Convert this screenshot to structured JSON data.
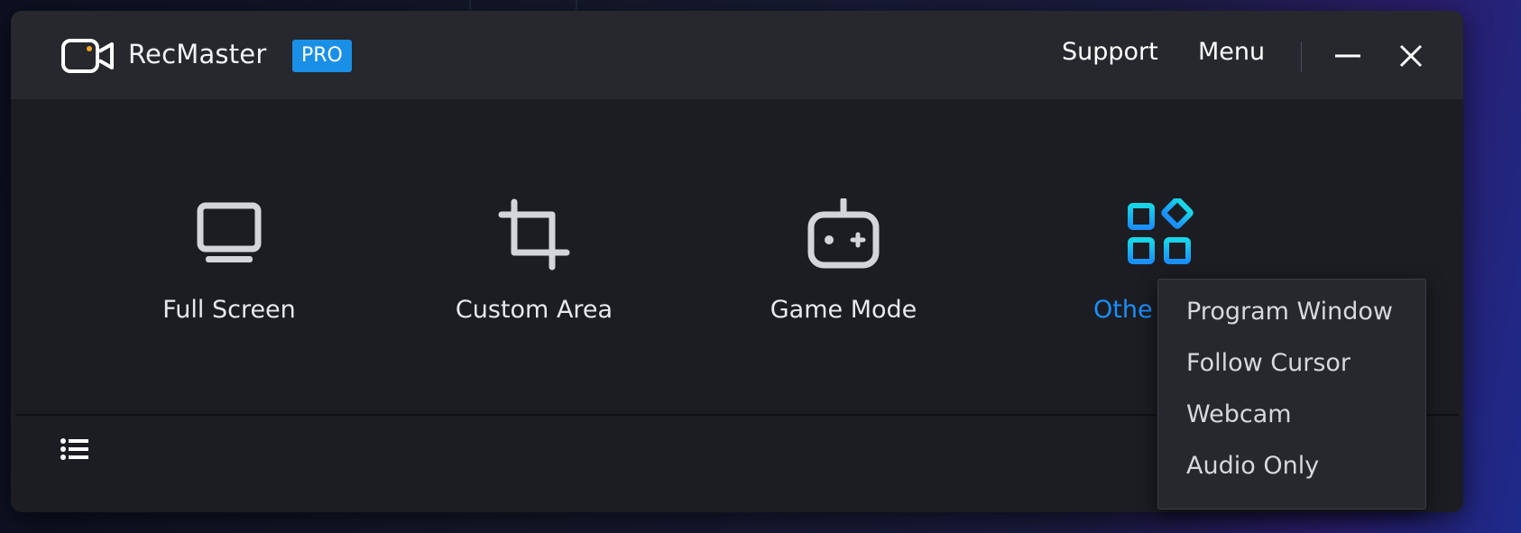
{
  "app": {
    "title": "RecMaster",
    "badge": "PRO"
  },
  "titlebar": {
    "support_label": "Support",
    "menu_label": "Menu"
  },
  "modes": [
    {
      "label": "Full Screen",
      "icon": "monitor-icon"
    },
    {
      "label": "Custom Area",
      "icon": "crop-icon"
    },
    {
      "label": "Game Mode",
      "icon": "gamepad-icon"
    },
    {
      "label": "Othe",
      "icon": "apps-grid-icon"
    }
  ],
  "dropdown": {
    "items": [
      {
        "label": "Program Window"
      },
      {
        "label": "Follow Cursor"
      },
      {
        "label": "Webcam"
      },
      {
        "label": "Audio Only"
      }
    ]
  },
  "colors": {
    "accent": "#1a8fff",
    "badge": "#1a8fe6",
    "icon_cyan": "#18c8e8",
    "logo_dot": "#f5a623"
  }
}
